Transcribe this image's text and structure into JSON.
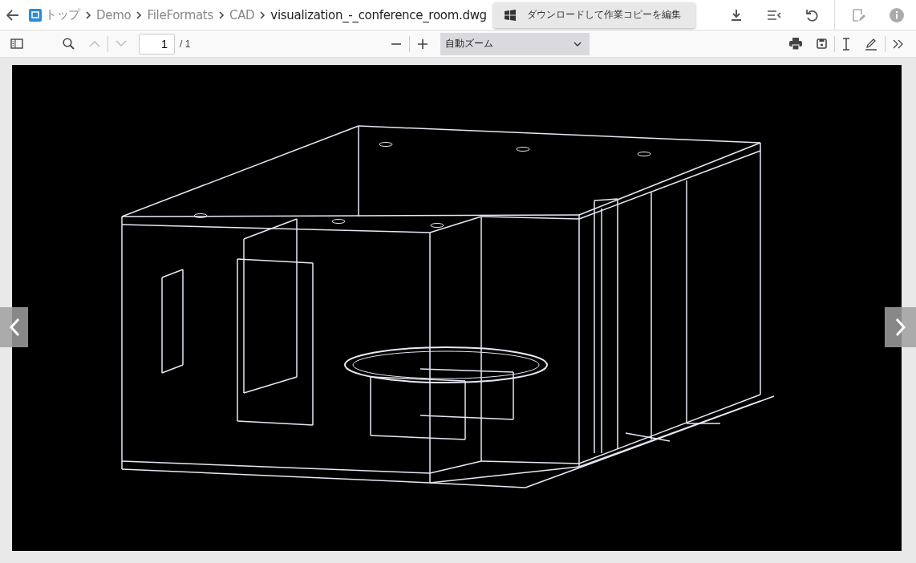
{
  "breadcrumb": [
    {
      "label": "トップ"
    },
    {
      "label": "Demo"
    },
    {
      "label": "FileFormats"
    },
    {
      "label": "CAD"
    }
  ],
  "file_name": "visualization_-_conference_room.dwg",
  "edit_button": {
    "label": "ダウンロードして作業コピーを編集"
  },
  "toolbar": {
    "page_number": "1",
    "page_total": "/ 1",
    "zoom": "自動ズーム"
  }
}
